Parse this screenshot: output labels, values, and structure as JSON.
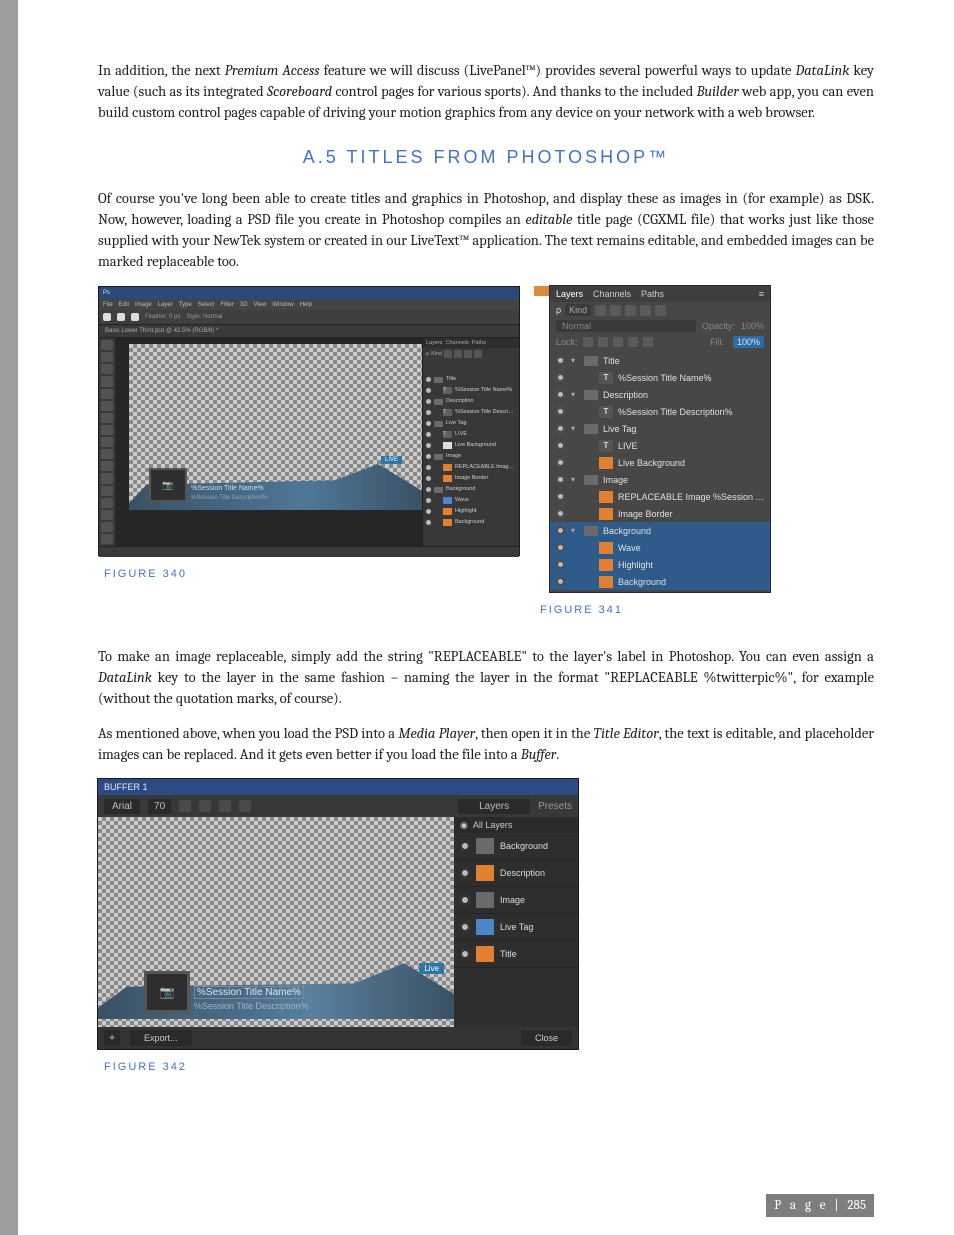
{
  "para1": {
    "s1a": "In addition, the next ",
    "s1b": "Premium Access",
    "s1c": " feature we will discuss (LivePanel™) provides several powerful ways to update ",
    "s1d": "DataLink",
    "s1e": " key value (such as its integrated ",
    "s1f": "Scoreboard",
    "s1g": " control pages for various sports).   And thanks to the included ",
    "s1h": "Builder",
    "s1i": " web app, you can even build custom control pages capable of driving your motion graphics from any device on your network with a web browser."
  },
  "section_heading": "A.5 TITLES FROM PHOTOSHOP™",
  "para2": {
    "a": "Of course you've long been able to create titles and graphics in Photoshop, and display these as images in (for example) as DSK.  Now, however, loading a PSD file you create in Photoshop compiles an ",
    "b": "editable",
    "c": " title page (CGXML file) that works just like those supplied with your NewTek system or created in our LiveText™ application.  The text remains editable, and embedded images can be marked replaceable too."
  },
  "fig340": {
    "caption": "FIGURE 340",
    "titlebar": "Ps",
    "menu": [
      "File",
      "Edit",
      "Image",
      "Layer",
      "Type",
      "Select",
      "Filter",
      "3D",
      "View",
      "Window",
      "Help"
    ],
    "tab": "Basic Lower Third.psd @ 42.5% (RGB/8) *",
    "canvas_tag": "LIVE",
    "canvas_text1": "%Session Title Name%",
    "canvas_text2": "%Session Title Description%",
    "panel_tabs": [
      "Layers",
      "Channels",
      "Paths"
    ],
    "kind_label": "Kind",
    "layers": [
      {
        "thumb": "folder",
        "name": "Title"
      },
      {
        "thumb": "T",
        "name": "%Session Title Name%",
        "indent": "1"
      },
      {
        "thumb": "folder",
        "name": "Description"
      },
      {
        "thumb": "T",
        "name": "%Session Title Description%",
        "indent": "1"
      },
      {
        "thumb": "folder",
        "name": "Live Tag"
      },
      {
        "thumb": "T",
        "name": "LIVE",
        "indent": "1"
      },
      {
        "thumb": "white",
        "name": "Live Background",
        "indent": "1"
      },
      {
        "thumb": "folder",
        "name": "Image"
      },
      {
        "thumb": "orange",
        "name": "REPLACEABLE Image %Session Title Image%",
        "indent": "1"
      },
      {
        "thumb": "orange",
        "name": "Image Border",
        "indent": "1"
      },
      {
        "thumb": "folder",
        "name": "Background"
      },
      {
        "thumb": "blue",
        "name": "Wave",
        "indent": "1"
      },
      {
        "thumb": "orange",
        "name": "Highlight",
        "indent": "1"
      },
      {
        "thumb": "orange",
        "name": "Background",
        "indent": "1"
      }
    ]
  },
  "fig341": {
    "caption": "FIGURE 341",
    "tabs": [
      "Layers",
      "Channels",
      "Paths"
    ],
    "filter_kind": "Kind",
    "mode": "Normal",
    "opacity_label": "Opacity:",
    "opacity_value": "100%",
    "lock_label": "Lock:",
    "fill_label": "Fill:",
    "fill_value": "100%",
    "layers": [
      {
        "kind": "group",
        "name": "Title",
        "caret": "▾"
      },
      {
        "kind": "T",
        "name": "%Session Title Name%",
        "indent": "1"
      },
      {
        "kind": "group",
        "name": "Description",
        "caret": "▾"
      },
      {
        "kind": "T",
        "name": "%Session Title Description%",
        "indent": "1"
      },
      {
        "kind": "group",
        "name": "Live Tag",
        "caret": "▾"
      },
      {
        "kind": "T",
        "name": "LIVE",
        "indent": "1"
      },
      {
        "kind": "orange",
        "name": "Live Background",
        "indent": "1"
      },
      {
        "kind": "group",
        "name": "Image",
        "caret": "▾"
      },
      {
        "kind": "orange",
        "name": "REPLACEABLE Image %Session Title Image%",
        "indent": "1"
      },
      {
        "kind": "orange",
        "name": "Image Border",
        "indent": "1"
      },
      {
        "kind": "group",
        "name": "Background",
        "caret": "▾",
        "sel": true
      },
      {
        "kind": "orange",
        "name": "Wave",
        "indent": "1",
        "sel": true
      },
      {
        "kind": "orange",
        "name": "Highlight",
        "indent": "1",
        "sel": true
      },
      {
        "kind": "orange",
        "name": "Background",
        "indent": "1",
        "sel": true
      }
    ]
  },
  "para3": {
    "a": "To make an image replaceable, simply add the string \"REPLACEABLE\" to the layer's label in Photoshop.  You can even assign a ",
    "b": "DataLink",
    "c": " key to the layer in the same fashion – naming the layer in the format \"REPLACEABLE %twitterpic%\", for example (without the quotation marks, of course)."
  },
  "para4": {
    "a": "As mentioned above, when you load the PSD into a ",
    "b": "Media Player",
    "c": ", then open it in the ",
    "d": "Title Editor",
    "e": ", the text is editable, and placeholder images can be replaced.  And it gets even better if you load the file into a ",
    "f": "Buffer",
    "g": "."
  },
  "fig342": {
    "caption": "FIGURE 342",
    "title": "BUFFER 1",
    "font": "Arial",
    "font_size": "70",
    "tabs": [
      "Layers",
      "Presets"
    ],
    "all_layers": "All Layers",
    "layers": [
      {
        "name": "Background",
        "thumb": "bg"
      },
      {
        "name": "Description",
        "thumb": "orange"
      },
      {
        "name": "Image",
        "thumb": "bg"
      },
      {
        "name": "Live Tag",
        "thumb": "blue"
      },
      {
        "name": "Title",
        "thumb": "orange"
      }
    ],
    "canvas_tag": "Live",
    "canvas_text1": "%Session Title Name%",
    "canvas_text2": "%Session Title Description%",
    "export": "Export...",
    "close": "Close"
  },
  "footer": {
    "label": "P a g e",
    "sep": " | ",
    "num": "285"
  }
}
